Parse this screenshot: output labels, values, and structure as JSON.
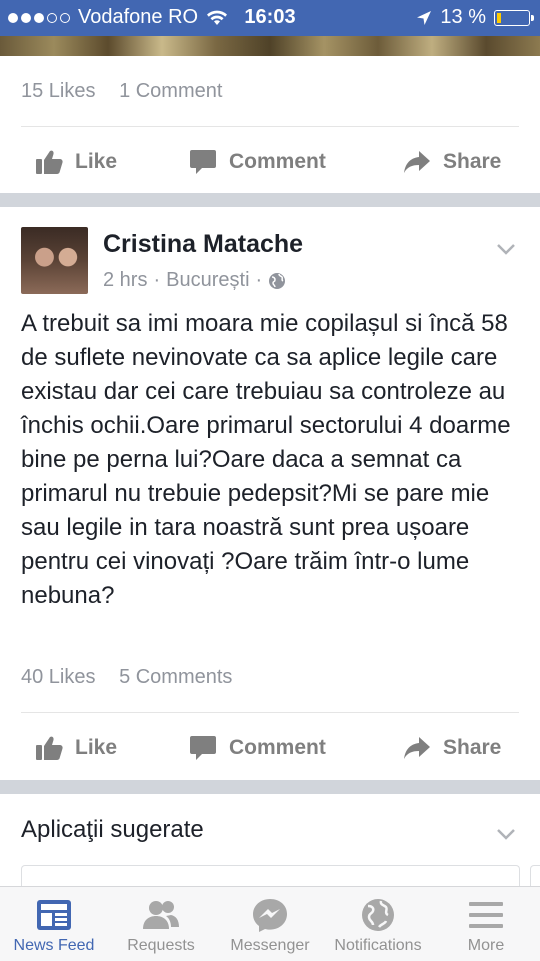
{
  "status_bar": {
    "carrier": "Vodafone RO",
    "time": "16:03",
    "battery": "13 %",
    "battery_level": 0.13,
    "signal_bars_filled": 3,
    "signal_bars_total": 5
  },
  "post_above": {
    "likes": "15 Likes",
    "comments": "1 Comment"
  },
  "action_bar": {
    "like": "Like",
    "comment": "Comment",
    "share": "Share"
  },
  "post": {
    "author": "Cristina Matache",
    "time": "2 hrs",
    "location": "București",
    "separator": "·",
    "text": "A trebuit sa imi moara mie copilașul si încă 58 de suflete nevinovate ca sa aplice legile care existau dar cei care trebuiau sa controleze au închis ochii.Oare primarul sectorului 4 doarme bine pe perna lui?Oare daca a semnat ca primarul nu trebuie pedepsit?Mi se pare mie sau legile in tara noastră sunt prea ușoare pentru cei vinovați ?Oare trăim într-o lume nebuna?",
    "likes": "40 Likes",
    "comments": "5 Comments"
  },
  "suggested": {
    "title": "Aplicaţii sugerate"
  },
  "tabs": [
    {
      "label": "News Feed",
      "icon": "news-feed-icon",
      "active": true
    },
    {
      "label": "Requests",
      "icon": "requests-icon",
      "active": false
    },
    {
      "label": "Messenger",
      "icon": "messenger-icon",
      "active": false
    },
    {
      "label": "Notifications",
      "icon": "globe-icon",
      "active": false
    },
    {
      "label": "More",
      "icon": "menu-icon",
      "active": false
    }
  ],
  "colors": {
    "brand": "#4267b2",
    "battery_fill": "#ffcc00",
    "muted_text": "#90949c",
    "action_gray": "#7f7f7f"
  }
}
